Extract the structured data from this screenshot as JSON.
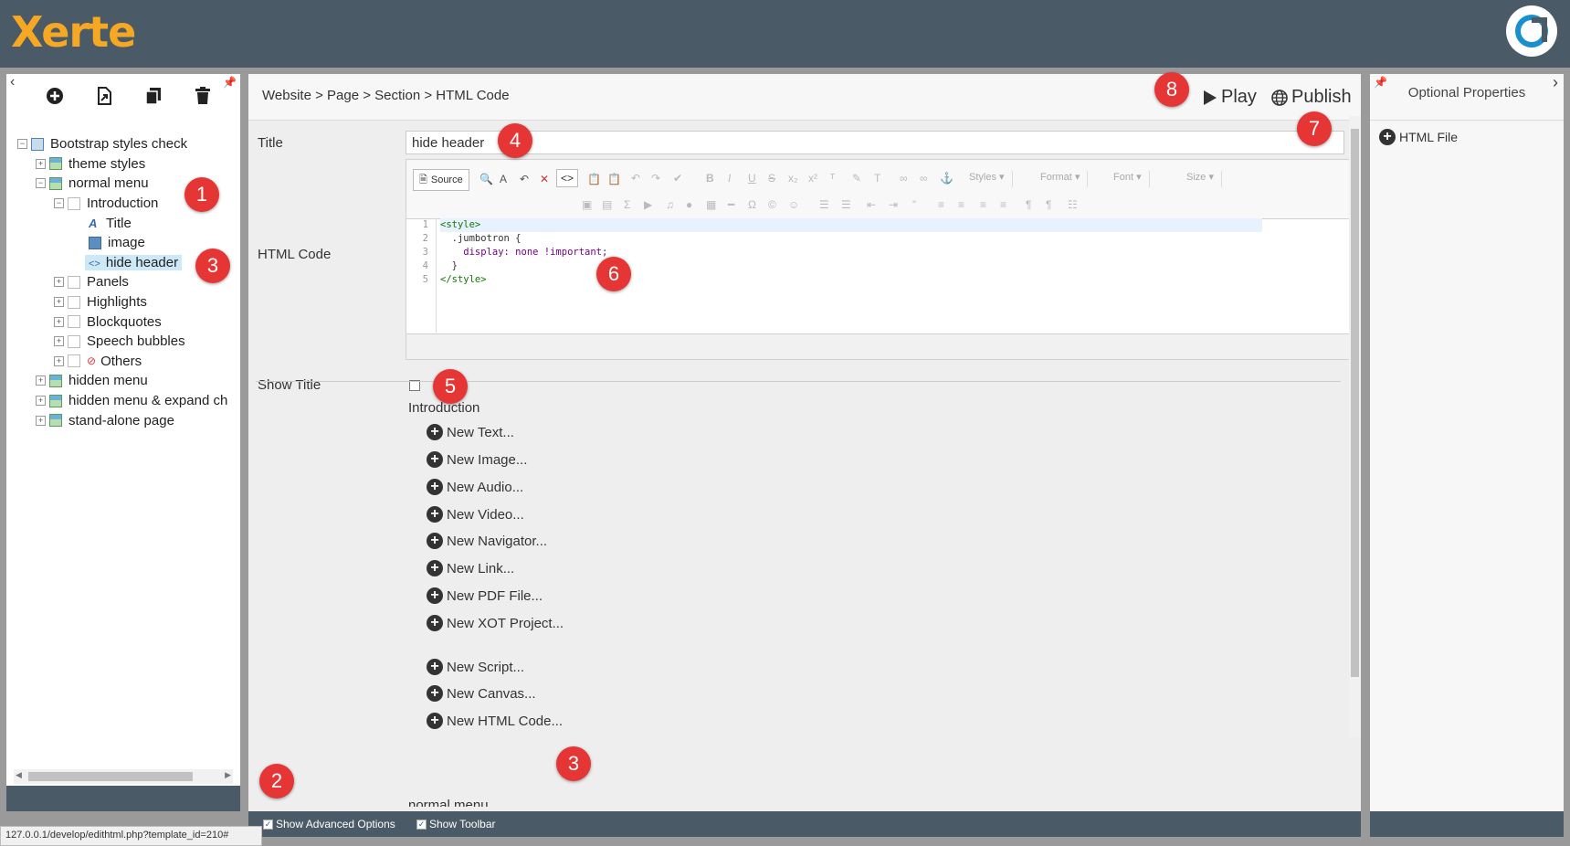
{
  "app": {
    "logo_text": "Xerte"
  },
  "left": {
    "tree": [
      {
        "label": "Bootstrap styles check",
        "icon": "book"
      },
      {
        "label": "theme styles",
        "icon": "grid"
      },
      {
        "label": "normal menu",
        "icon": "grid"
      },
      {
        "label": "Introduction",
        "icon": "page"
      },
      {
        "label": "Title",
        "icon": "text"
      },
      {
        "label": "image",
        "icon": "image"
      },
      {
        "label": "hide header",
        "icon": "code"
      },
      {
        "label": "Panels",
        "icon": "page"
      },
      {
        "label": "Highlights",
        "icon": "page"
      },
      {
        "label": "Blockquotes",
        "icon": "page"
      },
      {
        "label": "Speech bubbles",
        "icon": "page"
      },
      {
        "label": "Others",
        "icon": "page"
      },
      {
        "label": "hidden menu",
        "icon": "grid"
      },
      {
        "label": "hidden menu & expand ch",
        "icon": "grid"
      },
      {
        "label": "stand-alone page",
        "icon": "grid"
      }
    ]
  },
  "main": {
    "breadcrumb": "Website > Page > Section > HTML Code",
    "play_label": "Play",
    "publish_label": "Publish",
    "title_label": "Title",
    "title_value": "hide header",
    "html_code_label": "HTML Code",
    "show_title_label": "Show Title",
    "editor": {
      "source_label": "Source",
      "styles_label": "Styles",
      "format_label": "Format",
      "font_label": "Font",
      "size_label": "Size",
      "line_numbers": [
        "1",
        "2",
        "3",
        "4",
        "5"
      ],
      "code_lines": [
        "<style>",
        "  .jumbotron {",
        "    display: none !important;",
        "  }",
        "</style>"
      ]
    },
    "new_section_title": "Introduction",
    "new_items": [
      "New Text...",
      "New Image...",
      "New Audio...",
      "New Video...",
      "New Navigator...",
      "New Link...",
      "New PDF File...",
      "New XOT Project...",
      "New Script...",
      "New Canvas...",
      "New HTML Code..."
    ],
    "next_section_title": "normal menu",
    "show_advanced_label": "Show Advanced Options",
    "show_toolbar_label": "Show Toolbar"
  },
  "right": {
    "title": "Optional Properties",
    "items": [
      "HTML File"
    ]
  },
  "status_url": "127.0.0.1/develop/edithtml.php?template_id=210#",
  "callouts": [
    "1",
    "3",
    "4",
    "6",
    "5",
    "8",
    "7",
    "2",
    "3"
  ],
  "colors": {
    "topbar": "#4a5a66",
    "logo": "#f7a823",
    "callout": "#e53535",
    "selection": "#cde8f7"
  }
}
